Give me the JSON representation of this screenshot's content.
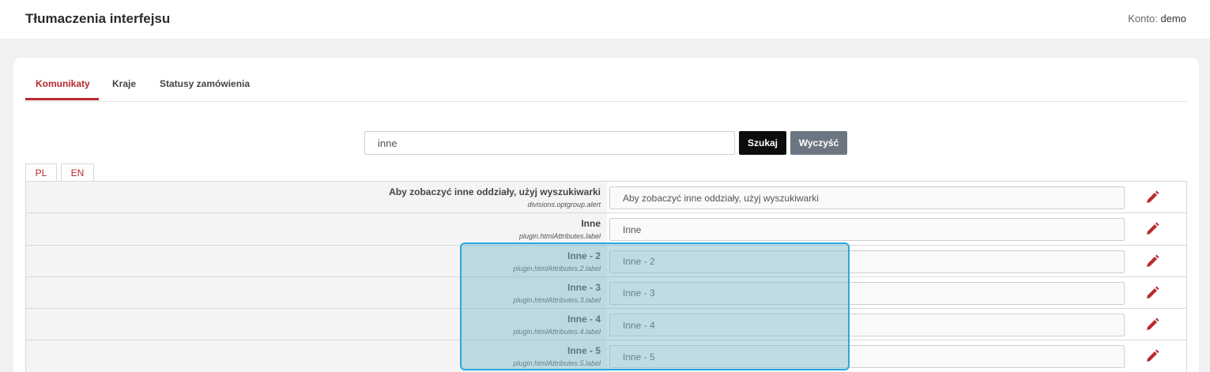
{
  "header": {
    "title": "Tłumaczenia interfejsu",
    "account_label": "Konto:",
    "account_value": "demo"
  },
  "tabs": [
    {
      "label": "Komunikaty",
      "active": true
    },
    {
      "label": "Kraje",
      "active": false
    },
    {
      "label": "Statusy zamówienia",
      "active": false
    }
  ],
  "search": {
    "value": "inne",
    "search_button": "Szukaj",
    "clear_button": "Wyczyść"
  },
  "languages": [
    {
      "label": "PL",
      "active": true
    },
    {
      "label": "EN",
      "active": false
    }
  ],
  "rows": [
    {
      "label": "Aby zobaczyć inne oddziały, użyj wyszukiwarki",
      "key": "divisions.optgroup.alert",
      "value": "Aby zobaczyć inne oddziały, użyj wyszukiwarki"
    },
    {
      "label": "Inne",
      "key": "plugin.htmlAttributes.label",
      "value": "Inne"
    },
    {
      "label": "Inne - 2",
      "key": "plugin.htmlAttributes.2.label",
      "value": "Inne - 2"
    },
    {
      "label": "Inne - 3",
      "key": "plugin.htmlAttributes.3.label",
      "value": "Inne - 3"
    },
    {
      "label": "Inne - 4",
      "key": "plugin.htmlAttributes.4.label",
      "value": "Inne - 4"
    },
    {
      "label": "Inne - 5",
      "key": "plugin.htmlAttributes.5.label",
      "value": "Inne - 5"
    }
  ],
  "colors": {
    "accent": "#b8292f",
    "highlight_border": "#2aa8e0",
    "clear_button": "#6c7682",
    "search_button": "#0c0c0c"
  },
  "icons": {
    "edit": "pencil-icon"
  }
}
